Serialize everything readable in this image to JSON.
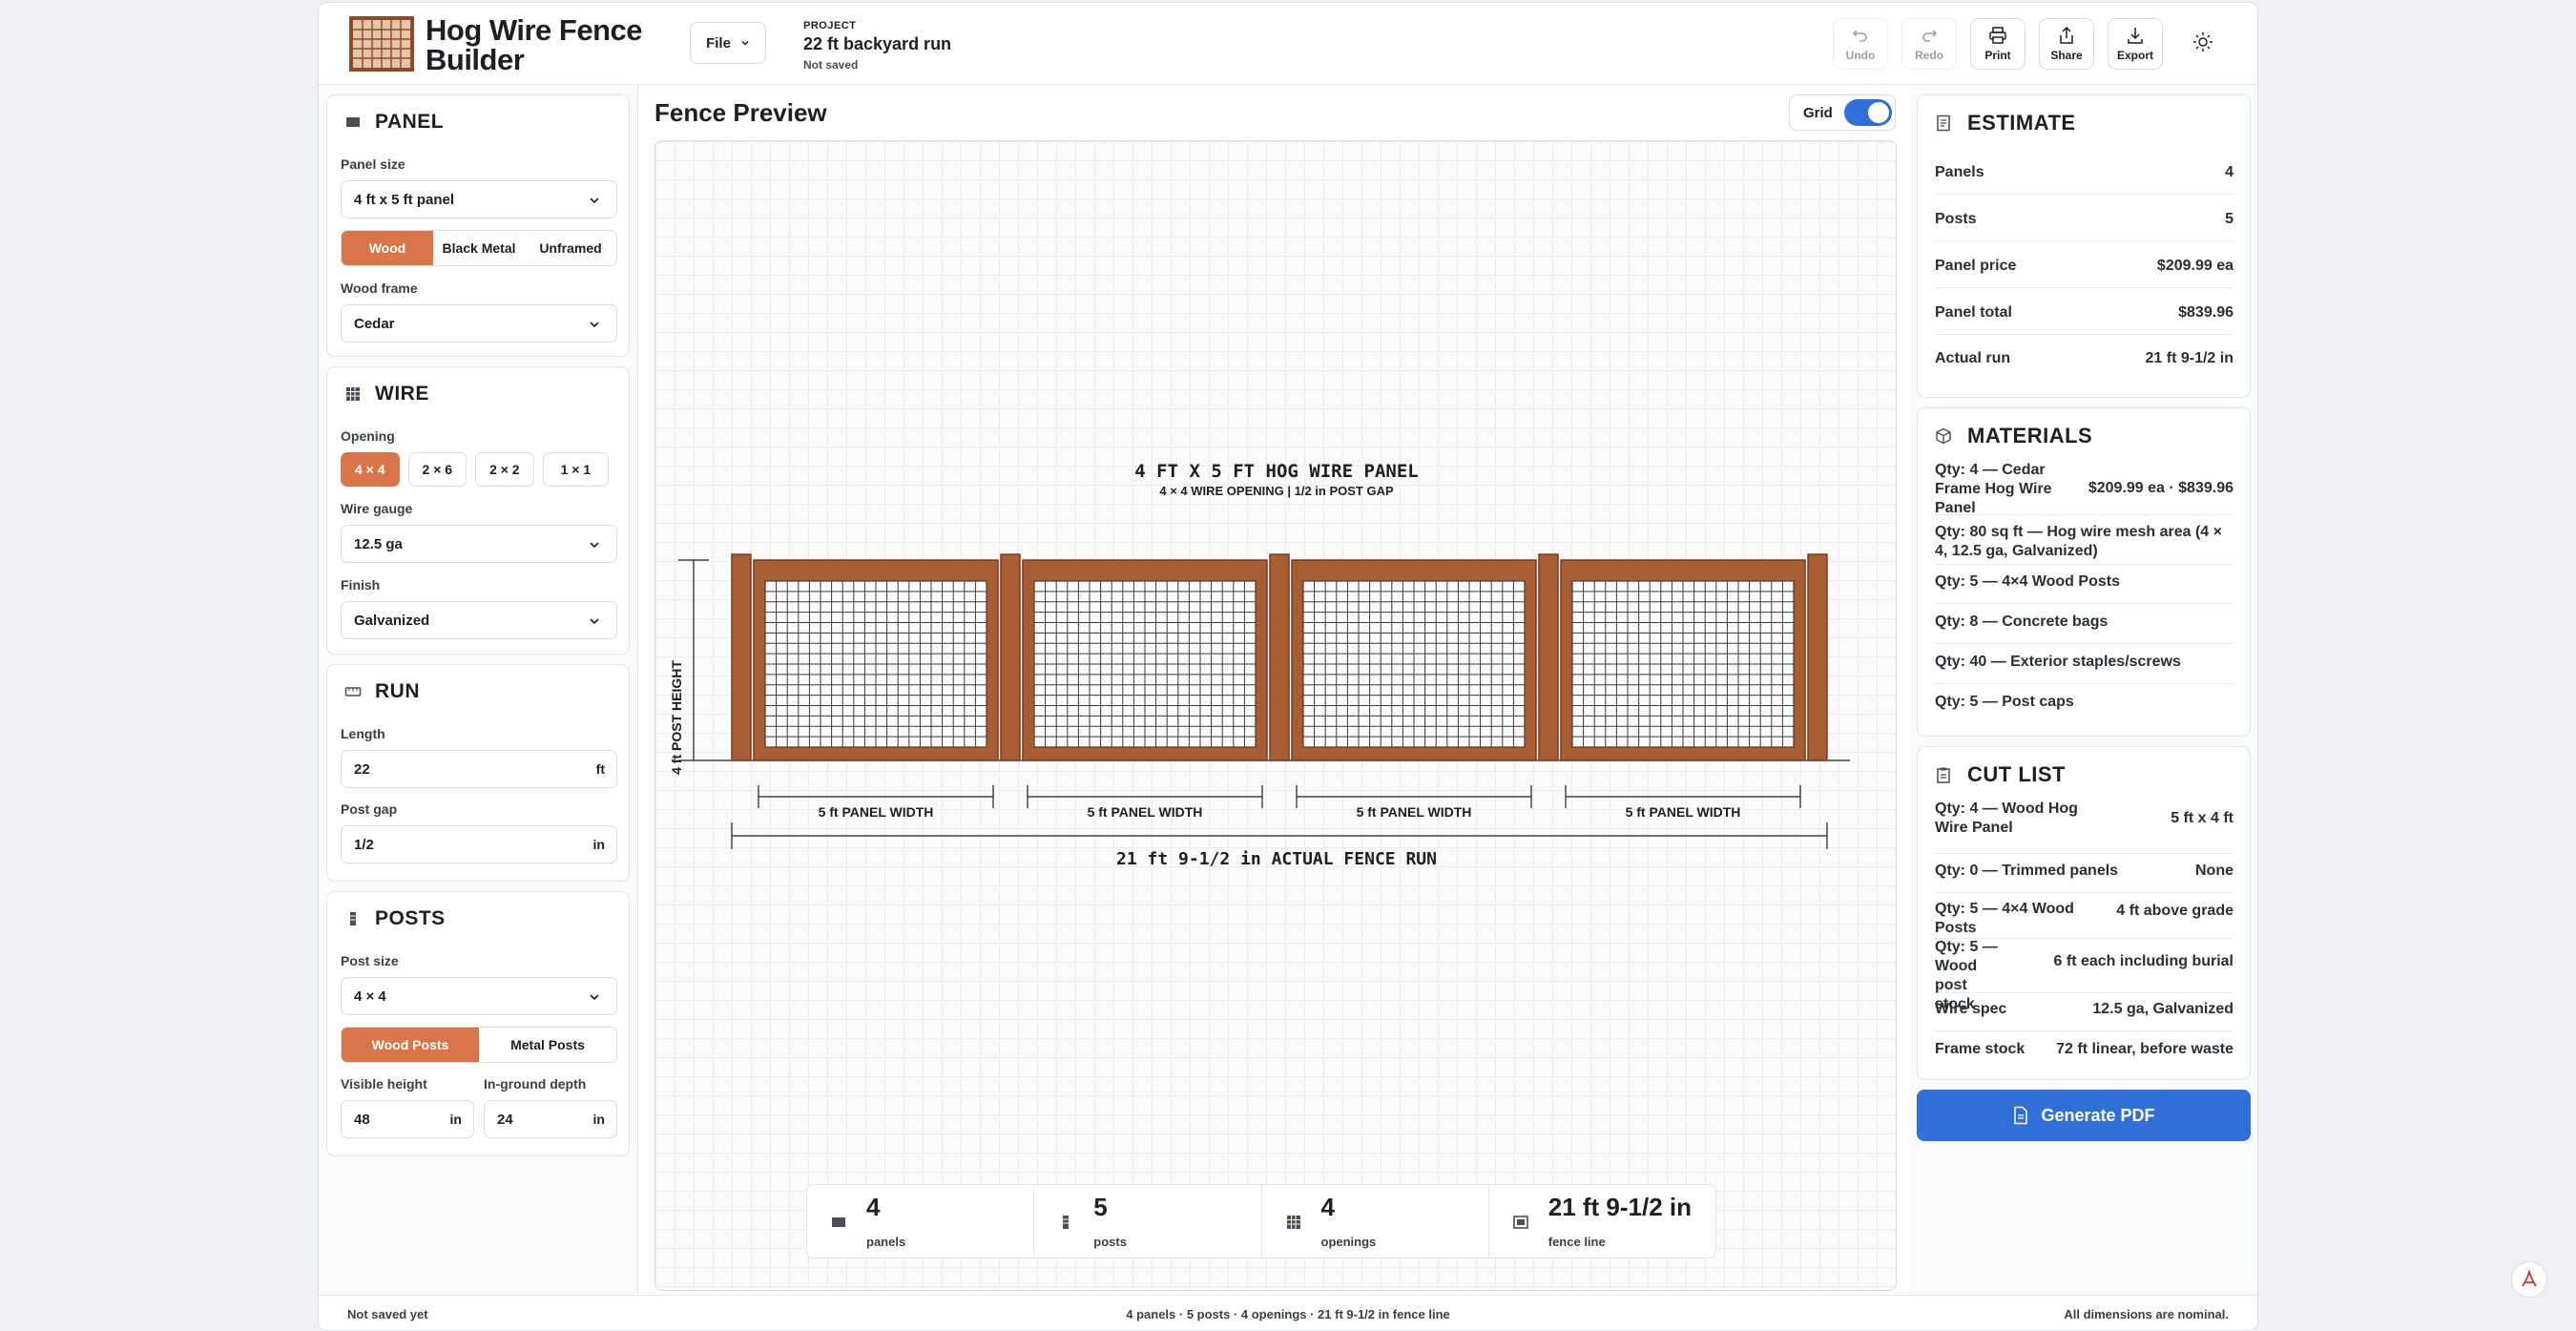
{
  "app": {
    "title": "Hog Wire Fence Builder"
  },
  "header": {
    "file_label": "File",
    "project_label": "PROJECT",
    "project_name": "22 ft backyard run",
    "save_status": "Not saved",
    "undo": "Undo",
    "redo": "Redo",
    "print": "Print",
    "share": "Share",
    "export": "Export"
  },
  "panel": {
    "title": "PANEL",
    "size_label": "Panel size",
    "size_value": "4 ft x 5 ft panel",
    "materials": [
      "Wood",
      "Black Metal",
      "Unframed"
    ],
    "material_selected": "Wood",
    "frame_label": "Wood frame",
    "frame_value": "Cedar"
  },
  "wire": {
    "title": "WIRE",
    "opening_label": "Opening",
    "openings": [
      "4 × 4",
      "2 × 6",
      "2 × 2",
      "1 × 1"
    ],
    "opening_selected": "4 × 4",
    "gauge_label": "Wire gauge",
    "gauge_value": "12.5 ga",
    "finish_label": "Finish",
    "finish_value": "Galvanized"
  },
  "run": {
    "title": "RUN",
    "length_label": "Length",
    "length_value": "22",
    "length_unit": "ft",
    "gap_label": "Post gap",
    "gap_value": "1/2",
    "gap_unit": "in"
  },
  "posts": {
    "title": "POSTS",
    "size_label": "Post size",
    "size_value": "4 × 4",
    "types": [
      "Wood Posts",
      "Metal Posts"
    ],
    "type_selected": "Wood Posts",
    "visible_label": "Visible height",
    "visible_value": "48",
    "visible_unit": "in",
    "depth_label": "In-ground depth",
    "depth_value": "24",
    "depth_unit": "in"
  },
  "preview": {
    "title": "Fence Preview",
    "grid_label": "Grid",
    "grid_on": true,
    "drawing_title": "4 FT X 5 FT HOG WIRE PANEL",
    "drawing_subtitle": "4 × 4 WIRE OPENING | 1/2 in POST GAP",
    "height_label": "4 ft POST HEIGHT",
    "panel_width_labels": [
      "5 ft PANEL WIDTH",
      "5 ft PANEL WIDTH",
      "5 ft PANEL WIDTH",
      "5 ft PANEL WIDTH"
    ],
    "run_label": "21 ft 9-1/2 in ACTUAL FENCE RUN",
    "panel_count": 4,
    "colors": {
      "frame": "#a85d35",
      "frame_dark": "#7a3d1f",
      "wire": "#3a3a3a"
    }
  },
  "stats": [
    {
      "value": "4",
      "label": "panels",
      "icon": "panel-icon"
    },
    {
      "value": "5",
      "label": "posts",
      "icon": "post-icon"
    },
    {
      "value": "4",
      "label": "openings",
      "icon": "grid-icon"
    },
    {
      "value": "21 ft 9-1/2 in",
      "label": "fence line",
      "icon": "ruler-icon"
    }
  ],
  "estimate": {
    "title": "ESTIMATE",
    "rows": [
      {
        "k": "Panels",
        "v": "4"
      },
      {
        "k": "Posts",
        "v": "5"
      },
      {
        "k": "Panel price",
        "v": "$209.99 ea"
      },
      {
        "k": "Panel total",
        "v": "$839.96"
      },
      {
        "k": "Actual run",
        "v": "21 ft 9-1/2 in"
      }
    ]
  },
  "materials": {
    "title": "MATERIALS",
    "rows": [
      {
        "k": "Qty: 4 — Cedar Frame Hog Wire Panel",
        "v": "$209.99 ea · $839.96"
      },
      {
        "k": "Qty: 80 sq ft — Hog wire mesh area (4 × 4, 12.5 ga, Galvanized)",
        "v": ""
      },
      {
        "k": "Qty: 5 — 4×4 Wood Posts",
        "v": ""
      },
      {
        "k": "Qty: 8 — Concrete bags",
        "v": ""
      },
      {
        "k": "Qty: 40 — Exterior staples/screws",
        "v": ""
      },
      {
        "k": "Qty: 5 — Post caps",
        "v": ""
      }
    ]
  },
  "cutlist": {
    "title": "CUT LIST",
    "rows": [
      {
        "k": "Qty: 4 — Wood Hog Wire Panel",
        "v": "5 ft x 4 ft"
      },
      {
        "k": "Qty: 0 — Trimmed panels",
        "v": "None"
      },
      {
        "k": "Qty: 5 — 4×4 Wood Posts",
        "v": "4 ft above grade"
      },
      {
        "k": "Qty: 5 — Wood post stock",
        "v": "6 ft each including burial"
      },
      {
        "k": "Wire spec",
        "v": "12.5 ga, Galvanized"
      },
      {
        "k": "Frame stock",
        "v": "72 ft linear, before waste"
      }
    ],
    "generate_label": "Generate PDF"
  },
  "footer": {
    "left": "Not saved yet",
    "center": "4 panels · 5 posts · 4 openings · 21 ft 9-1/2 in fence line",
    "right": "All dimensions are nominal."
  }
}
